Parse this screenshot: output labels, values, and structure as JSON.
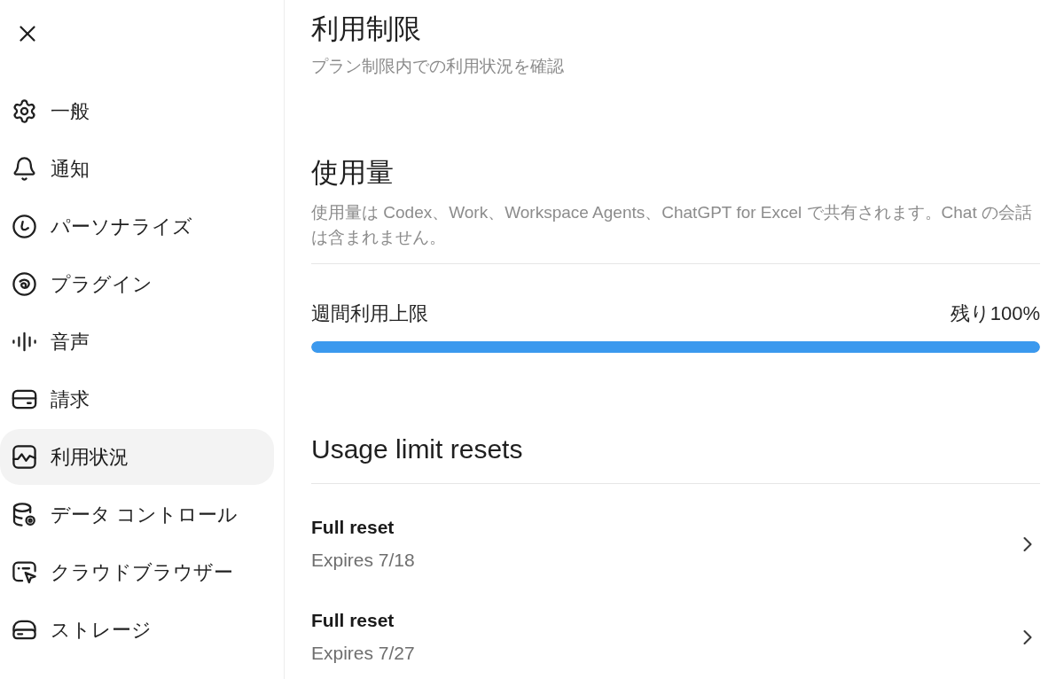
{
  "sidebar": {
    "items": [
      {
        "label": "一般",
        "selected": false
      },
      {
        "label": "通知",
        "selected": false
      },
      {
        "label": "パーソナライズ",
        "selected": false
      },
      {
        "label": "プラグイン",
        "selected": false
      },
      {
        "label": "音声",
        "selected": false
      },
      {
        "label": "請求",
        "selected": false
      },
      {
        "label": "利用状況",
        "selected": true
      },
      {
        "label": "データ コントロール",
        "selected": false
      },
      {
        "label": "クラウドブラウザー",
        "selected": false
      },
      {
        "label": "ストレージ",
        "selected": false
      }
    ]
  },
  "header": {
    "title": "利用制限",
    "subtitle": "プラン制限内での利用状況を確認"
  },
  "usage": {
    "title": "使用量",
    "description": "使用量は Codex、Work、Workspace Agents、ChatGPT for Excel で共有されます。Chat の会話は含まれません。",
    "meters": [
      {
        "label": "週間利用上限",
        "reading": "残り100%",
        "level": 1
      }
    ]
  },
  "resets": {
    "title": "Usage limit resets",
    "items": [
      {
        "title": "Full reset",
        "detail": "Expires 7/18"
      },
      {
        "title": "Full reset",
        "detail": "Expires 7/27"
      }
    ]
  }
}
